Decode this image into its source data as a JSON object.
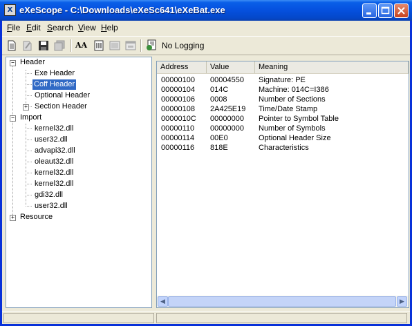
{
  "window": {
    "title": "eXeScope - C:\\Downloads\\eXeSc641\\eXeBat.exe"
  },
  "menu": [
    {
      "label": "File",
      "key": "F",
      "rest": "ile"
    },
    {
      "label": "Edit",
      "key": "E",
      "rest": "dit"
    },
    {
      "label": "Search",
      "key": "S",
      "rest": "earch"
    },
    {
      "label": "View",
      "key": "V",
      "rest": "iew"
    },
    {
      "label": "Help",
      "key": "H",
      "rest": "elp"
    }
  ],
  "toolbar": {
    "logging_label": "No Logging",
    "font_tool_label": "AA"
  },
  "tree": {
    "header": "Header",
    "exe_header": "Exe Header",
    "coff_header": "Coff Header",
    "optional_header": "Optional Header",
    "section_header": "Section Header",
    "import": "Import",
    "imports": [
      "kernel32.dll",
      "user32.dll",
      "advapi32.dll",
      "oleaut32.dll",
      "kernel32.dll",
      "kernel32.dll",
      "gdi32.dll",
      "user32.dll"
    ],
    "resource": "Resource"
  },
  "list": {
    "columns": [
      "Address",
      "Value",
      "Meaning"
    ],
    "rows": [
      [
        "00000100",
        "00004550",
        "Signature: PE"
      ],
      [
        "00000104",
        "014C",
        "Machine: 014C=I386"
      ],
      [
        "00000106",
        "0008",
        "Number of Sections"
      ],
      [
        "00000108",
        "2A425E19",
        "Time/Date Stamp"
      ],
      [
        "0000010C",
        "00000000",
        "Pointer to Symbol Table"
      ],
      [
        "00000110",
        "00000000",
        "Number of Symbols"
      ],
      [
        "00000114",
        "00E0",
        "Optional Header Size"
      ],
      [
        "00000116",
        "818E",
        "Characteristics"
      ]
    ]
  }
}
